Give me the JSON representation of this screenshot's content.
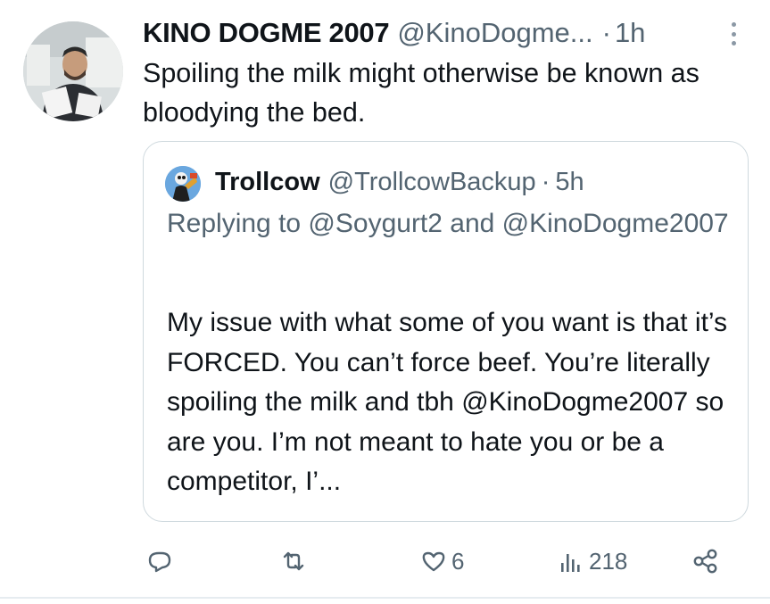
{
  "tweet": {
    "display_name": "KINO DOGME 2007",
    "handle": "@KinoDogme...",
    "dot": "·",
    "time": "1h",
    "text": "Spoiling the milk might otherwise be known as bloodying the bed.",
    "avatar_icon": "person-with-papers-avatar",
    "more_icon": "vertical-ellipsis-icon"
  },
  "quote": {
    "display_name": "Trollcow",
    "handle": "@TrollcowBackup",
    "dot": "·",
    "time": "5h",
    "replying_to": "Replying to @Soygurt2 and @KinoDogme2007",
    "text": "My issue with what some of you want is that it’s FORCED. You can’t force beef. You’re literally spoiling the milk and tbh @KinoDogme2007 so are you. I’m not meant to hate you or be a competitor, I’...",
    "avatar_icon": "cartoon-character-avatar"
  },
  "actions": {
    "reply": {
      "icon": "reply-bubble-icon",
      "count": ""
    },
    "repost": {
      "icon": "repost-icon",
      "count": ""
    },
    "like": {
      "icon": "heart-icon",
      "count": "6"
    },
    "views": {
      "icon": "views-bar-icon",
      "count": "218"
    },
    "share": {
      "icon": "share-icon",
      "count": ""
    }
  },
  "colors": {
    "text_primary": "#0f1419",
    "text_secondary": "#536471",
    "border": "#cfd9de"
  }
}
